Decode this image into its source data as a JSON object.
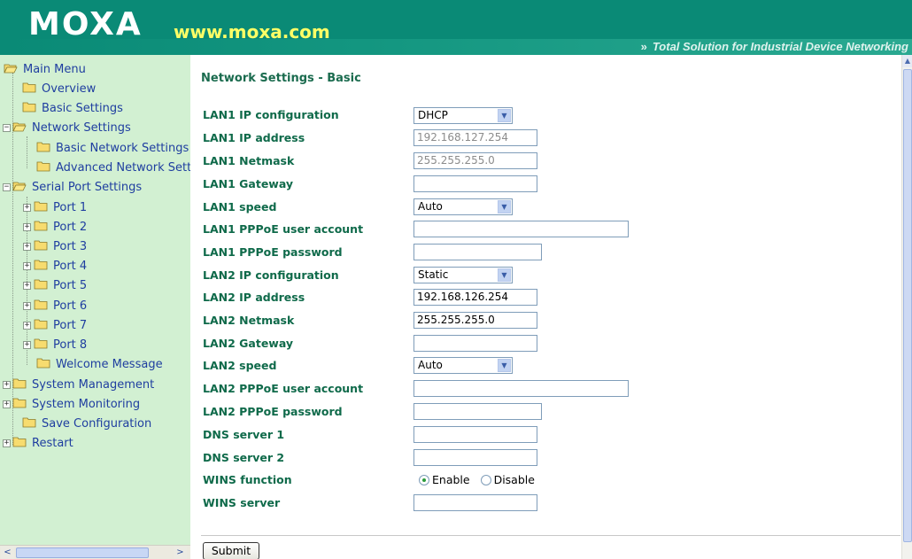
{
  "header": {
    "logo": "MOXA",
    "url": "www.moxa.com",
    "tagline": "Total Solution for Industrial Device Networking",
    "tagline_arrows": "»"
  },
  "sidebar": {
    "items": [
      {
        "label": "Main Menu"
      },
      {
        "label": "Overview"
      },
      {
        "label": "Basic Settings"
      },
      {
        "label": "Network Settings"
      },
      {
        "label": "Basic Network Settings"
      },
      {
        "label": "Advanced Network Settings"
      },
      {
        "label": "Serial Port Settings"
      },
      {
        "label": "Port 1"
      },
      {
        "label": "Port 2"
      },
      {
        "label": "Port 3"
      },
      {
        "label": "Port 4"
      },
      {
        "label": "Port 5"
      },
      {
        "label": "Port 6"
      },
      {
        "label": "Port 7"
      },
      {
        "label": "Port 8"
      },
      {
        "label": "Welcome Message"
      },
      {
        "label": "System Management"
      },
      {
        "label": "System Monitoring"
      },
      {
        "label": "Save Configuration"
      },
      {
        "label": "Restart"
      }
    ],
    "scroll_left": "<",
    "scroll_right": ">"
  },
  "main": {
    "title": "Network Settings - Basic",
    "labels": {
      "lan1_ip_config": "LAN1 IP configuration",
      "lan1_ip": "LAN1 IP address",
      "lan1_netmask": "LAN1 Netmask",
      "lan1_gateway": "LAN1 Gateway",
      "lan1_speed": "LAN1 speed",
      "lan1_pppoe_user": "LAN1 PPPoE user account",
      "lan1_pppoe_pass": "LAN1 PPPoE password",
      "lan2_ip_config": "LAN2 IP configuration",
      "lan2_ip": "LAN2 IP address",
      "lan2_netmask": "LAN2 Netmask",
      "lan2_gateway": "LAN2 Gateway",
      "lan2_speed": "LAN2 speed",
      "lan2_pppoe_user": "LAN2 PPPoE user account",
      "lan2_pppoe_pass": "LAN2 PPPoE password",
      "dns1": "DNS server 1",
      "dns2": "DNS server 2",
      "wins_function": "WINS function",
      "wins_server": "WINS server"
    },
    "values": {
      "lan1_ip_config": "DHCP",
      "lan1_ip": "192.168.127.254",
      "lan1_netmask": "255.255.255.0",
      "lan1_gateway": "",
      "lan1_speed": "Auto",
      "lan1_pppoe_user": "",
      "lan1_pppoe_pass": "",
      "lan2_ip_config": "Static",
      "lan2_ip": "192.168.126.254",
      "lan2_netmask": "255.255.255.0",
      "lan2_gateway": "",
      "lan2_speed": "Auto",
      "lan2_pppoe_user": "",
      "lan2_pppoe_pass": "",
      "dns1": "",
      "dns2": "",
      "wins_server": ""
    },
    "wins_options": {
      "enable": "Enable",
      "disable": "Disable",
      "selected": "Enable"
    },
    "submit_label": "Submit"
  },
  "colors": {
    "header_bg": "#0a8a76",
    "logo_url": "#ffff66",
    "sidebar_bg": "#d2f0d2",
    "label_green": "#0f6a4a",
    "link_blue": "#1f3ea0"
  }
}
